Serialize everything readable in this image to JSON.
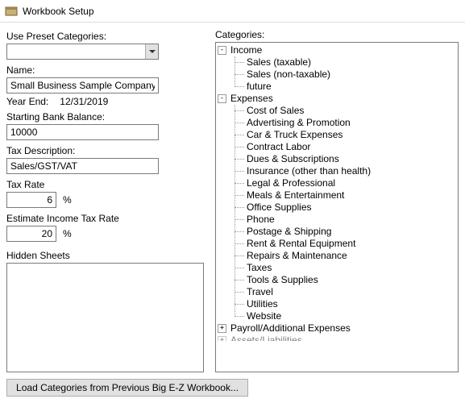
{
  "window": {
    "title": "Workbook Setup"
  },
  "left": {
    "preset_label": "Use Preset Categories:",
    "preset_value": "",
    "name_label": "Name:",
    "name_value": "Small Business Sample Company",
    "year_end_label": "Year End:",
    "year_end_value": "12/31/2019",
    "start_balance_label": "Starting Bank Balance:",
    "start_balance_value": "10000",
    "tax_desc_label": "Tax Description:",
    "tax_desc_value": "Sales/GST/VAT",
    "tax_rate_label": "Tax Rate",
    "tax_rate_value": "6",
    "pct": "%",
    "est_income_tax_label": "Estimate Income Tax Rate",
    "est_income_tax_value": "20",
    "hidden_sheets_label": "Hidden Sheets"
  },
  "right": {
    "categories_label": "Categories:"
  },
  "tree": {
    "income": {
      "label": "Income",
      "children": [
        "Sales (taxable)",
        "Sales (non-taxable)",
        "future"
      ]
    },
    "expenses": {
      "label": "Expenses",
      "children": [
        "Cost of Sales",
        "Advertising & Promotion",
        "Car & Truck Expenses",
        "Contract Labor",
        "Dues & Subscriptions",
        "Insurance (other than health)",
        "Legal & Professional",
        "Meals & Entertainment",
        "Office Supplies",
        "Phone",
        "Postage & Shipping",
        "Rent & Rental Equipment",
        "Repairs & Maintenance",
        "Taxes",
        "Tools & Supplies",
        "Travel",
        "Utilities",
        "Website"
      ]
    },
    "payroll": {
      "label": "Payroll/Additional Expenses"
    },
    "assets_cut": {
      "label": "Assets/Liabilities"
    }
  },
  "bottom": {
    "load_button": "Load Categories from Previous Big E-Z Workbook..."
  }
}
